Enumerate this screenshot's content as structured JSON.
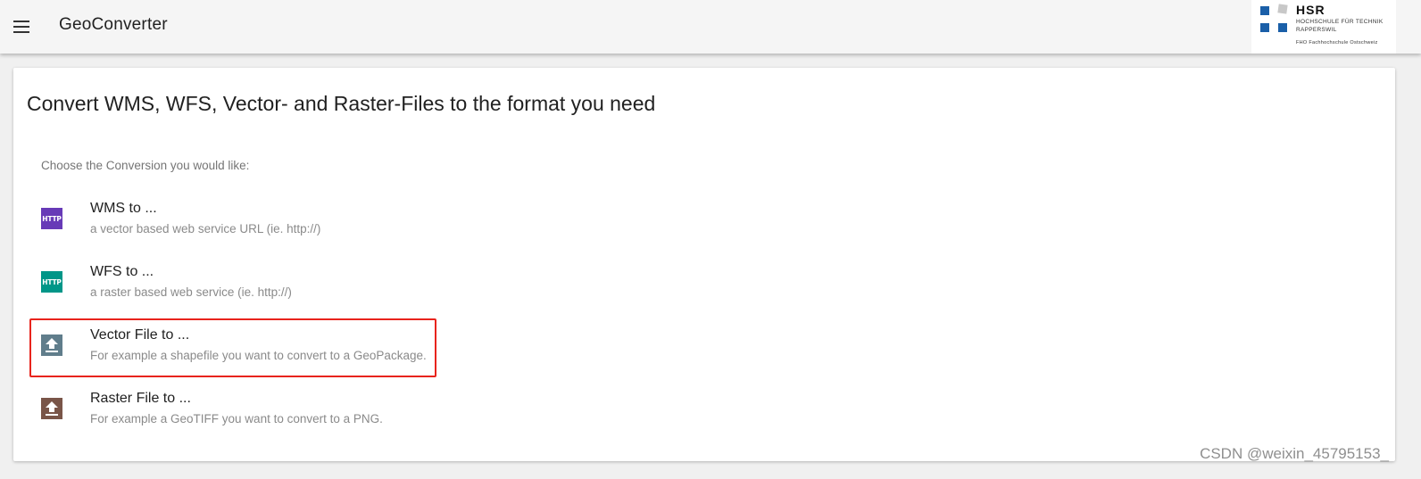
{
  "appbar": {
    "menu_icon": "menu-icon",
    "title": "GeoConverter",
    "logo": {
      "name": "HSR",
      "line1": "HOCHSCHULE FÜR TECHNIK",
      "line2": "RAPPERSWIL",
      "line3": "FHO Fachhochschule Ostschweiz",
      "colors": [
        "#1a5fa8",
        "#c8c8c8"
      ]
    }
  },
  "main": {
    "headline": "Convert WMS, WFS, Vector- and Raster-Files to the format you need",
    "subheader": "Choose the Conversion you would like:",
    "items": [
      {
        "title": "WMS to ...",
        "subtitle": "a vector based web service URL (ie. http://)",
        "icon": "http-icon",
        "icon_text": "HTTP",
        "color": "#673ab7"
      },
      {
        "title": "WFS to ...",
        "subtitle": "a raster based web service (ie. http://)",
        "icon": "http-icon",
        "icon_text": "HTTP",
        "color": "#009688"
      },
      {
        "title": "Vector File to ...",
        "subtitle": "For example a shapefile you want to convert to a GeoPackage.",
        "icon": "upload-icon",
        "color": "#607d8b",
        "highlighted": true
      },
      {
        "title": "Raster File to ...",
        "subtitle": "For example a GeoTIFF you want to convert to a PNG.",
        "icon": "upload-icon",
        "color": "#795548"
      }
    ]
  },
  "watermark": "CSDN @weixin_45795153_",
  "colors": {
    "highlight": "#e8241c",
    "appbar_bg": "#f5f5f5"
  }
}
